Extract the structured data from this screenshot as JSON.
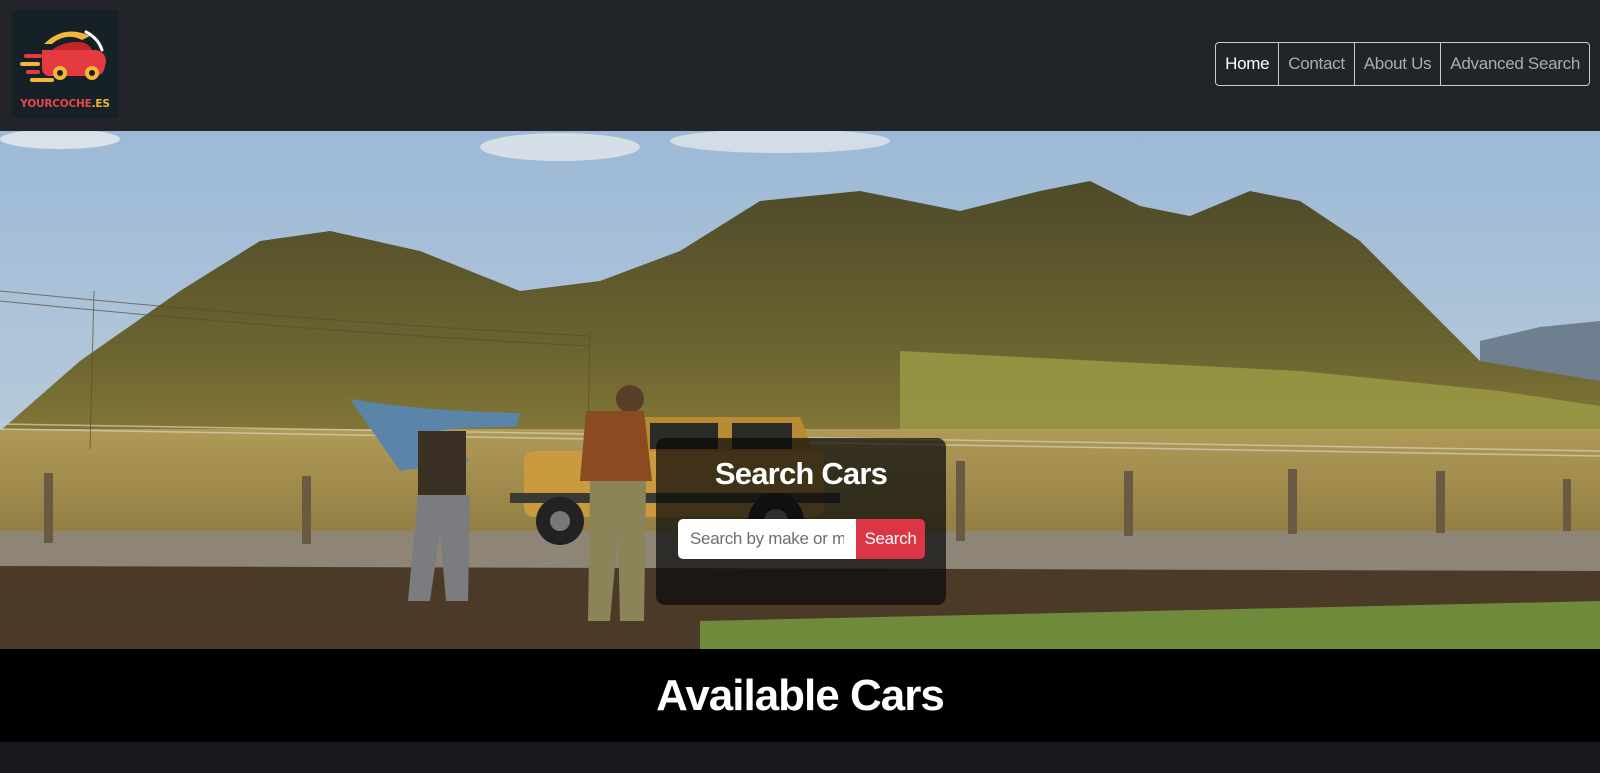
{
  "brand": {
    "logo_text_part1": "YOURCOCHE",
    "logo_text_part2": ".ES",
    "logo_icon": "car-speed-icon"
  },
  "nav": {
    "items": [
      {
        "label": "Home",
        "active": true
      },
      {
        "label": "Contact",
        "active": false
      },
      {
        "label": "About Us",
        "active": false
      },
      {
        "label": "Advanced Search",
        "active": false
      }
    ]
  },
  "hero": {
    "search": {
      "title": "Search Cars",
      "placeholder": "Search by make or model",
      "button_label": "Search"
    }
  },
  "section": {
    "title": "Available Cars"
  },
  "colors": {
    "header_bg": "#212429",
    "accent": "#dc3545",
    "logo_red": "#e8464a",
    "logo_yellow": "#f3b63a"
  }
}
